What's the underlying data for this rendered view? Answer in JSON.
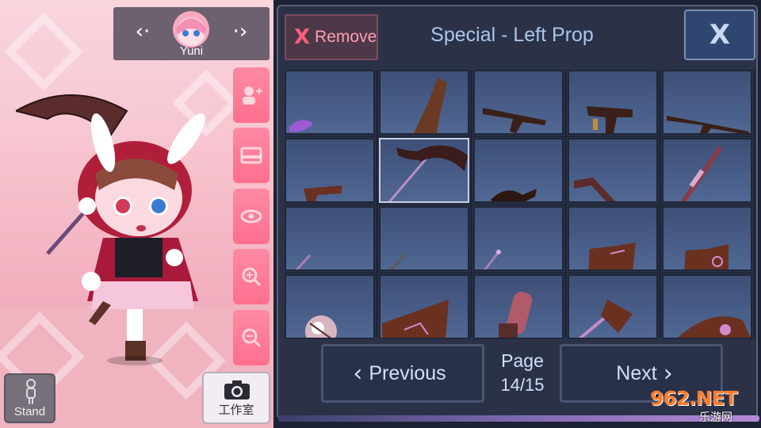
{
  "character": {
    "name": "Yuni"
  },
  "side_buttons": [
    {
      "icon": "add-character-icon"
    },
    {
      "icon": "scene-icon"
    },
    {
      "icon": "eye-icon"
    },
    {
      "icon": "zoom-in-icon"
    },
    {
      "icon": "zoom-out-icon"
    }
  ],
  "bottom_left": {
    "stand_label": "Stand",
    "studio_label": "工作室"
  },
  "panel": {
    "remove_x": "X",
    "remove_label": "Remove",
    "title": "Special - Left Prop",
    "close_label": "X"
  },
  "grid": {
    "items": [
      {
        "icon": "purple-flame-icon"
      },
      {
        "icon": "brown-horn-icon"
      },
      {
        "icon": "rifle-icon"
      },
      {
        "icon": "submachine-gun-icon"
      },
      {
        "icon": "sniper-rifle-icon"
      },
      {
        "icon": "pistol-icon"
      },
      {
        "icon": "scythe-icon",
        "selected": true
      },
      {
        "icon": "genie-lamp-icon"
      },
      {
        "icon": "crossbow-icon"
      },
      {
        "icon": "sword-icon"
      },
      {
        "icon": "wand-icon"
      },
      {
        "icon": "dagger-icon"
      },
      {
        "icon": "short-wand-icon"
      },
      {
        "icon": "spell-book-icon"
      },
      {
        "icon": "magic-book-icon"
      },
      {
        "icon": "crystal-orb-icon"
      },
      {
        "icon": "shield-icon"
      },
      {
        "icon": "chainsaw-icon"
      },
      {
        "icon": "axe-icon"
      },
      {
        "icon": "witch-hat-icon"
      }
    ]
  },
  "pagination": {
    "previous_label": "Previous",
    "next_label": "Next",
    "page_label": "Page",
    "page_value": "14/15"
  },
  "watermark": {
    "main": "962.NET",
    "sub": "乐游网"
  },
  "colors": {
    "panel_bg": "#2b3247",
    "cell_bg": "#506894",
    "accent_pink": "#ff6f8e",
    "title_blue": "#a9c6ec"
  }
}
